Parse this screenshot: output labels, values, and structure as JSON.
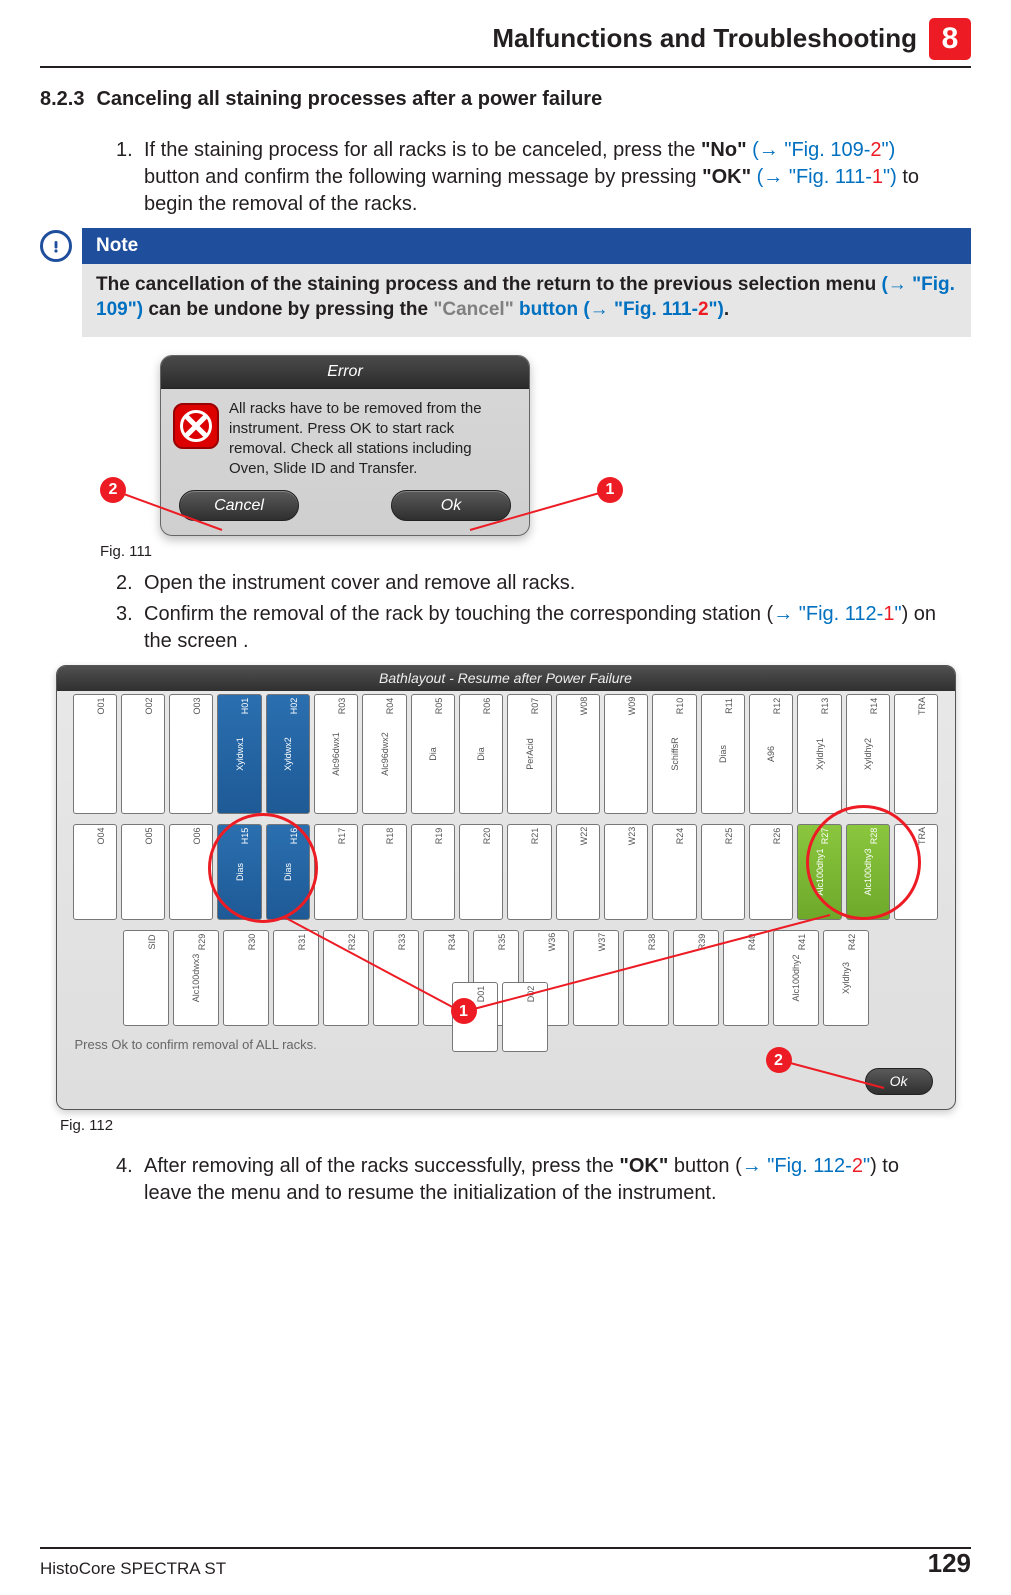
{
  "header": {
    "chapter_title": "Malfunctions and Troubleshooting",
    "chapter_number": "8"
  },
  "section": {
    "number": "8.2.3",
    "title": "Canceling all staining processes after a power failure"
  },
  "steps": {
    "s1": {
      "num": "1.",
      "t1": "If the staining process for all racks is to be canceled, press the ",
      "b1": "\"No\"",
      "l1a": " (→ \"Fig. 109-",
      "l1b": "2",
      "l1c": "\")",
      "t2": " button and confirm the following warning message by pressing ",
      "b2": "\"OK\"",
      "l2a": " (→ \"Fig. 111-",
      "l2b": "1",
      "l2c": "\")",
      "t3": " to begin the removal of the racks."
    },
    "s2": {
      "num": "2.",
      "text": "Open the instrument cover and remove all racks."
    },
    "s3": {
      "num": "3.",
      "t1": "Confirm the removal of the rack by touching the corresponding station (",
      "la": "→ \"Fig. 112-",
      "lb": "1",
      "lc": "\"",
      "t2": ") on the screen ."
    },
    "s4": {
      "num": "4.",
      "t1": "After removing all of the racks successfully, press the ",
      "b1": "\"OK\"",
      "t2": " button (",
      "la": "→ \"Fig. 112-",
      "lb": "2",
      "lc": "\"",
      "t3": ") to leave the menu and to resume the initialization of the instrument."
    }
  },
  "note": {
    "label": "Note",
    "text_a": "The cancellation of the staining process and the return to the previous selection menu ",
    "link1": "(→ \"Fig. 109\")",
    "text_b": " can be undone by pressing the ",
    "gray": "\"Cancel\"",
    "link2_a": " button (→ \"Fig. 111-",
    "link2_b": "2",
    "link2_c": "\")",
    "text_c": "."
  },
  "fig111": {
    "caption": "Fig. 111",
    "title": "Error",
    "message": "All racks have to be removed from the instrument. Press OK to start rack removal. Check all stations including Oven, Slide ID and Transfer.",
    "btn_cancel": "Cancel",
    "btn_ok": "Ok",
    "callout_1": "1",
    "callout_2": "2"
  },
  "fig112": {
    "caption": "Fig. 112",
    "title": "Bathlayout - Resume after Power Failure",
    "note": "Press Ok to confirm removal of ALL racks.",
    "ok_label": "Ok",
    "callout_1": "1",
    "callout_2": "2",
    "row1": [
      {
        "id": "O01",
        "lab": ""
      },
      {
        "id": "O02",
        "lab": ""
      },
      {
        "id": "O03",
        "lab": ""
      },
      {
        "id": "H01",
        "lab": "Xyldwx1",
        "cls": "v-blue"
      },
      {
        "id": "H02",
        "lab": "Xyldwx2",
        "cls": "v-blue"
      },
      {
        "id": "R03",
        "lab": "Alc96dwx1"
      },
      {
        "id": "R04",
        "lab": "Alc96dwx2"
      },
      {
        "id": "R05",
        "lab": "Dia"
      },
      {
        "id": "R06",
        "lab": "Dia"
      },
      {
        "id": "R07",
        "lab": "PerAcid"
      },
      {
        "id": "W08",
        "lab": ""
      },
      {
        "id": "W09",
        "lab": ""
      },
      {
        "id": "R10",
        "lab": "SchiffsR"
      },
      {
        "id": "R11",
        "lab": "Dias"
      },
      {
        "id": "R12",
        "lab": "A96"
      },
      {
        "id": "R13",
        "lab": "Xyldhy1"
      },
      {
        "id": "R14",
        "lab": "Xyldhy2"
      },
      {
        "id": "TRA",
        "lab": ""
      }
    ],
    "row2": [
      {
        "id": "O04",
        "lab": ""
      },
      {
        "id": "O05",
        "lab": ""
      },
      {
        "id": "O06",
        "lab": ""
      },
      {
        "id": "H15",
        "lab": "Dias",
        "cls": "v-blue"
      },
      {
        "id": "H16",
        "lab": "Dias",
        "cls": "v-blue"
      },
      {
        "id": "R17",
        "lab": ""
      },
      {
        "id": "R18",
        "lab": ""
      },
      {
        "id": "R19",
        "lab": ""
      },
      {
        "id": "R20",
        "lab": ""
      },
      {
        "id": "R21",
        "lab": ""
      },
      {
        "id": "W22",
        "lab": ""
      },
      {
        "id": "W23",
        "lab": ""
      },
      {
        "id": "R24",
        "lab": ""
      },
      {
        "id": "R25",
        "lab": ""
      },
      {
        "id": "R26",
        "lab": ""
      },
      {
        "id": "R27",
        "lab": "Alc100dhy1",
        "cls": "v-green"
      },
      {
        "id": "R28",
        "lab": "Alc100dhy3",
        "cls": "v-green"
      },
      {
        "id": "TRA",
        "lab": ""
      }
    ],
    "row3": [
      {
        "id": "SID",
        "lab": ""
      },
      {
        "id": "R29",
        "lab": "Alc100dwx3"
      },
      {
        "id": "R30",
        "lab": ""
      },
      {
        "id": "R31",
        "lab": ""
      },
      {
        "id": "R32",
        "lab": ""
      },
      {
        "id": "R33",
        "lab": ""
      },
      {
        "id": "R34",
        "lab": ""
      },
      {
        "id": "R35",
        "lab": ""
      },
      {
        "id": "W36",
        "lab": ""
      },
      {
        "id": "W37",
        "lab": ""
      },
      {
        "id": "R38",
        "lab": ""
      },
      {
        "id": "R39",
        "lab": ""
      },
      {
        "id": "R40",
        "lab": ""
      },
      {
        "id": "R41",
        "lab": "Alc100dhy2"
      },
      {
        "id": "R42",
        "lab": "Xyldhy3"
      }
    ],
    "row4": [
      {
        "id": "D01",
        "lab": ""
      },
      {
        "id": "D02",
        "lab": ""
      }
    ]
  },
  "footer": {
    "product": "HistoCore SPECTRA ST",
    "page": "129"
  }
}
